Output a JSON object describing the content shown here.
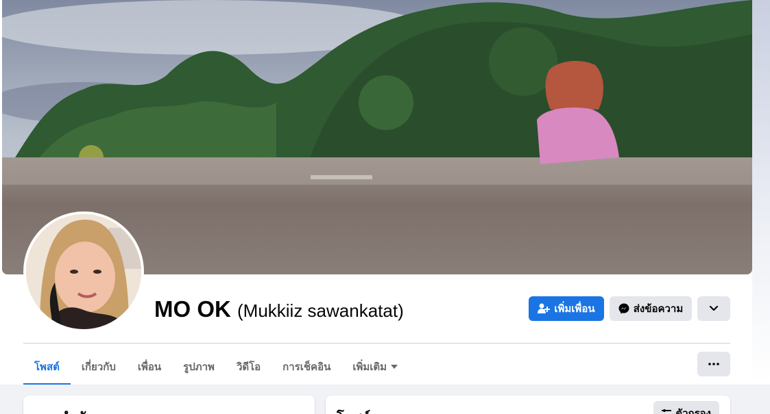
{
  "profile": {
    "name": "MO OK",
    "alternate_name": "(Mukkiiz sawankatat)"
  },
  "actions": {
    "add_friend_label": "เพิ่มเพื่อน",
    "message_label": "ส่งข้อความ"
  },
  "tabs": [
    {
      "label": "โพสต์",
      "active": true
    },
    {
      "label": "เกี่ยวกับ",
      "active": false
    },
    {
      "label": "เพื่อน",
      "active": false
    },
    {
      "label": "รูปภาพ",
      "active": false
    },
    {
      "label": "วิดีโอ",
      "active": false
    },
    {
      "label": "การเช็คอิน",
      "active": false
    },
    {
      "label": "เพิ่มเติม",
      "active": false
    }
  ],
  "tab_more_icon": "ellipsis-icon",
  "intro_card": {
    "title": "แนะนำตัว"
  },
  "posts_card": {
    "title": "โพสต์",
    "filter_label": "ตัวกรอง"
  },
  "colors": {
    "accent": "#1b74e4",
    "button_gray": "#e4e6eb",
    "text_secondary": "#65676b"
  }
}
